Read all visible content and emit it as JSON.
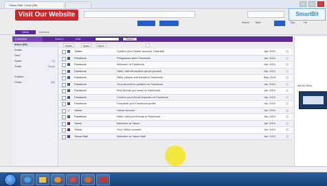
{
  "browser": {
    "tabs": [
      {
        "label": "Yahoo Mail - Inbox (86)"
      },
      {
        "label": ""
      }
    ]
  },
  "banner": {
    "text": "Visit Our Website"
  },
  "header": {
    "buttons": [
      "",
      ""
    ],
    "links": [
      "Home",
      "Mail",
      "",
      "Tips",
      "He"
    ]
  },
  "watermark": {
    "text": "SmartBit"
  },
  "nav": {
    "active_tab": "Inbox",
    "other_tab": "Contacts",
    "right_text": ""
  },
  "mail_toolbar": {
    "compose": "Compose",
    "labels": [
      "Search",
      "Mail",
      ""
    ],
    "search_value": "",
    "go_label": "Search"
  },
  "sidebar": {
    "header": "Inbox (86)",
    "items": [
      {
        "label": "Drafts",
        "count": ""
      },
      {
        "label": "Sent",
        "count": ""
      },
      {
        "label": "Spam",
        "count": "(2)"
      },
      {
        "label": "Trash",
        "count": "Empty"
      },
      {
        "label": "Folders",
        "count": ""
      },
      {
        "label": "Chats",
        "count": "(86)"
      }
    ]
  },
  "list_toolbar": {
    "buttons": [
      "Delete",
      "Spam",
      "Move",
      ""
    ]
  },
  "messages": [
    {
      "sender": "Twitter",
      "subject": "Confirm your Twitter account, Smartbit!",
      "date": "Jan, 2014",
      "flag": "#3a5ba0"
    },
    {
      "sender": "Facebook",
      "subject": "Pengaturan akun Facebook",
      "date": "Jan, 2014",
      "flag": "#3a5ba0"
    },
    {
      "sender": "Facebook",
      "subject": "Welcome to Facebook",
      "date": "Jan, 2014",
      "flag": "#3a5ba0"
    },
    {
      "sender": "Facebook",
      "subject": "Hello, add information about yourself",
      "date": "Jan, 2014",
      "flag": "#3a5ba0"
    },
    {
      "sender": "Facebook",
      "subject": "Hello, please add friends to Facebook",
      "date": "May, 2014",
      "flag": "#3a5ba0"
    },
    {
      "sender": "Facebook",
      "subject": "Your account is updated on Facebook",
      "date": "Jan, 2014",
      "flag": "#3a5ba0"
    },
    {
      "sender": "Facebook",
      "subject": "Find friends you know on Facebook",
      "date": "Jan, 2014",
      "flag": "#3a5ba0"
    },
    {
      "sender": "Facebook",
      "subject": "Confirm your friend requests on Facebook",
      "date": "Jan, 2014",
      "flag": "#3a5ba0"
    },
    {
      "sender": "Facebook",
      "subject": "Complete your Facebook profile",
      "date": "Jan, 2014",
      "flag": "#3a5ba0"
    },
    {
      "sender": "Yahoo",
      "subject": "Yahoo account",
      "date": "Jan, 2014",
      "flag": "#cfd3db"
    },
    {
      "sender": "Facebook",
      "subject": "Hello, add your friends to Facebook",
      "date": "Jan, 2014",
      "flag": "#3a5ba0"
    },
    {
      "sender": "Yahoo",
      "subject": "Welcome to Yahoo",
      "date": "Jan, 2014",
      "flag": "#5b2b9e"
    },
    {
      "sender": "Yahoo",
      "subject": "Your Yahoo account",
      "date": "Jan, 2014",
      "flag": "#5b2b9e"
    },
    {
      "sender": "Yahoo Mail",
      "subject": "Welcome to Yahoo Mail",
      "date": "Jan, 2014",
      "flag": "#5b2b9e"
    }
  ],
  "pager": "",
  "right_panel": {
    "text": "Ads by Yahoo"
  },
  "statusbar": "",
  "taskbar": {
    "clock": ""
  }
}
